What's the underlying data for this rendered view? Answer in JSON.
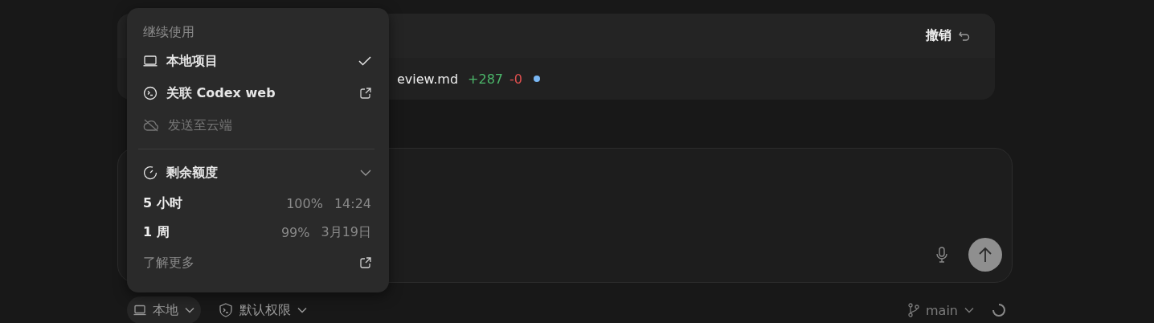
{
  "changes_card": {
    "undo_button": "撤销",
    "file": {
      "name": "eview.md",
      "added": "+287",
      "removed": "-0"
    }
  },
  "menu": {
    "section_title": "继续使用",
    "items": [
      {
        "kind": "local",
        "label": "本地项目",
        "checked": true,
        "external": false,
        "disabled": false
      },
      {
        "kind": "web",
        "label": "关联 Codex web",
        "checked": false,
        "external": true,
        "disabled": false
      },
      {
        "kind": "cloud",
        "label": "发送至云端",
        "checked": false,
        "external": false,
        "disabled": true
      }
    ],
    "quota": {
      "title": "剩余额度",
      "expanded": true,
      "rows": [
        {
          "label": "5 小时",
          "percent": "100%",
          "reset": "14:24"
        },
        {
          "label": "1 周",
          "percent": "99%",
          "reset": "3月19日"
        }
      ],
      "link": "了解更多"
    }
  },
  "toolbar": {
    "mode_button": {
      "label": "本地",
      "selected": true
    },
    "permissions_button": "默认权限",
    "branch": "main"
  }
}
